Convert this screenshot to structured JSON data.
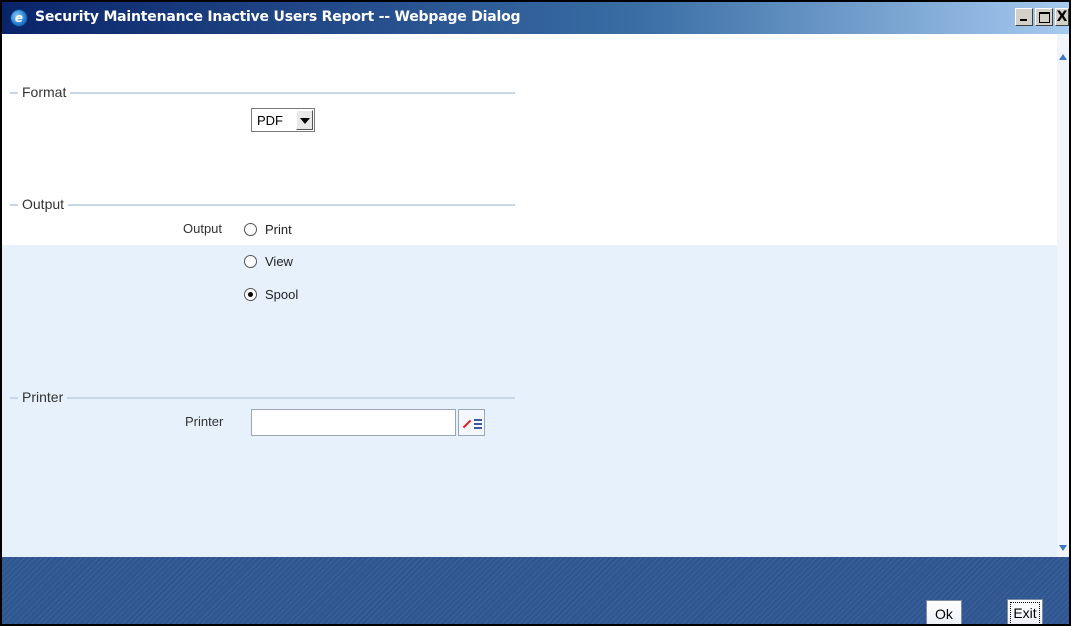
{
  "window": {
    "title": "Security Maintenance Inactive Users Report -- Webpage Dialog",
    "icon": "ie-icon",
    "controls": [
      "minimize-icon",
      "maximize-icon",
      "close-icon"
    ],
    "close_glyph": "X"
  },
  "format": {
    "section_label": "Format",
    "select_value": "PDF"
  },
  "output": {
    "section_label": "Output",
    "field_label": "Output",
    "options": [
      {
        "label": "Print",
        "checked": false
      },
      {
        "label": "View",
        "checked": false
      },
      {
        "label": "Spool",
        "checked": true
      }
    ]
  },
  "printer": {
    "section_label": "Printer",
    "field_label": "Printer",
    "value": ""
  },
  "footer": {
    "ok_label": "Ok",
    "exit_label": "Exit"
  },
  "colors": {
    "footer_bg": "#2f5690",
    "form_bg": "#e6f1fb",
    "section_line": "#c6d6e8"
  }
}
